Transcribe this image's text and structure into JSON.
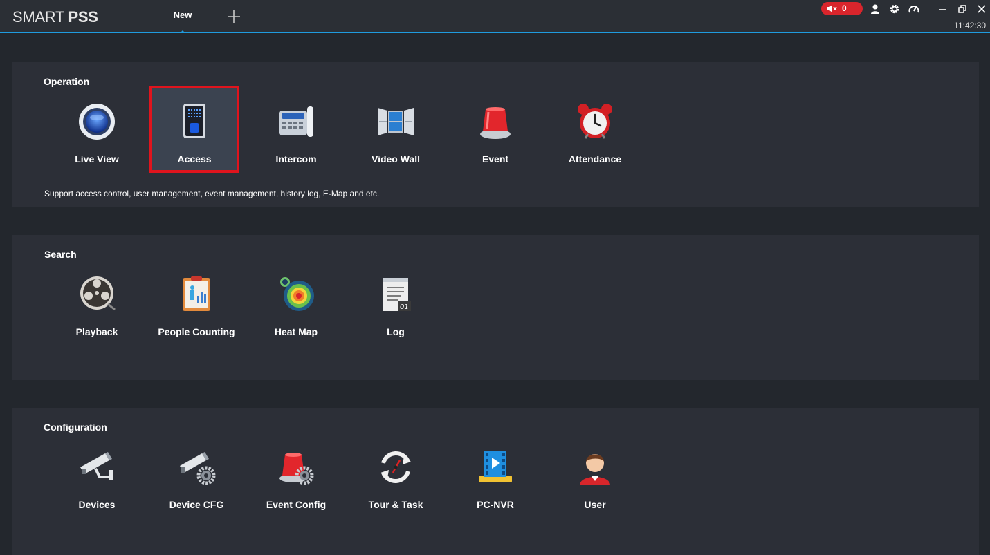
{
  "app": {
    "brand_light": "SMART ",
    "brand_bold": "PSS",
    "tab_new": "New",
    "alarm_count": "0",
    "clock": "11:42:30",
    "accent": "#1f9bde",
    "alarm_color": "#d9252c"
  },
  "operation": {
    "title": "Operation",
    "description": "Support access control, user management, event management, history log, E-Map and etc.",
    "items": [
      {
        "label": "Live View",
        "icon": "live-view-icon"
      },
      {
        "label": "Access",
        "icon": "access-icon",
        "selected": true
      },
      {
        "label": "Intercom",
        "icon": "intercom-icon"
      },
      {
        "label": "Video Wall",
        "icon": "video-wall-icon"
      },
      {
        "label": "Event",
        "icon": "event-icon"
      },
      {
        "label": "Attendance",
        "icon": "attendance-icon"
      }
    ]
  },
  "search": {
    "title": "Search",
    "items": [
      {
        "label": "Playback",
        "icon": "playback-icon"
      },
      {
        "label": "People Counting",
        "icon": "people-counting-icon"
      },
      {
        "label": "Heat Map",
        "icon": "heat-map-icon"
      },
      {
        "label": "Log",
        "icon": "log-icon"
      }
    ]
  },
  "configuration": {
    "title": "Configuration",
    "items": [
      {
        "label": "Devices",
        "icon": "devices-icon"
      },
      {
        "label": "Device CFG",
        "icon": "device-cfg-icon"
      },
      {
        "label": "Event Config",
        "icon": "event-config-icon"
      },
      {
        "label": "Tour & Task",
        "icon": "tour-task-icon"
      },
      {
        "label": "PC-NVR",
        "icon": "pc-nvr-icon"
      },
      {
        "label": "User",
        "icon": "user-icon"
      }
    ]
  }
}
